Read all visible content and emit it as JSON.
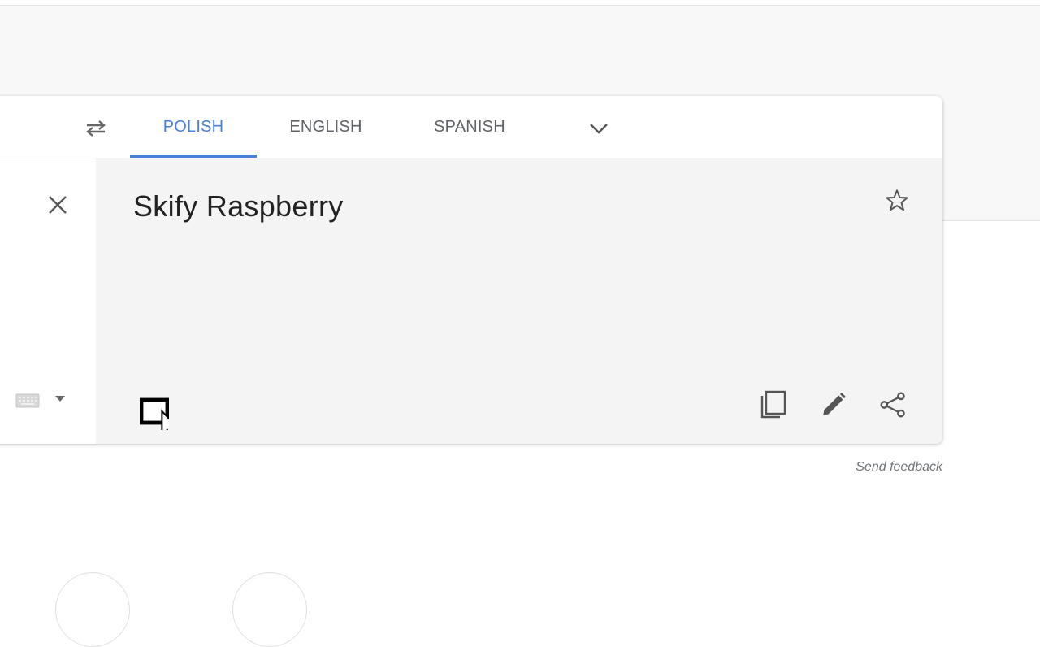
{
  "language_bar": {
    "tabs": [
      {
        "label": "POLISH",
        "active": true
      },
      {
        "label": "ENGLISH",
        "active": false
      },
      {
        "label": "SPANISH",
        "active": false
      }
    ],
    "swap_icon": "swap-arrows-icon",
    "more_icon": "chevron-down-icon"
  },
  "source": {
    "clear_icon": "close-icon",
    "keyboard_icon": "keyboard-icon",
    "keyboard_menu_icon": "caret-down-icon"
  },
  "translation": {
    "text": "Skify Raspberry",
    "star_icon": "star-outline-icon",
    "tools": [
      "copy-icon",
      "pencil-icon",
      "share-icon"
    ]
  },
  "footer": {
    "send_feedback": "Send feedback"
  },
  "colors": {
    "accent": "#4a7fd6",
    "tab_text": "#5f6368",
    "target_bg": "#f4f4f4",
    "page_band": "#f8f8f8"
  }
}
